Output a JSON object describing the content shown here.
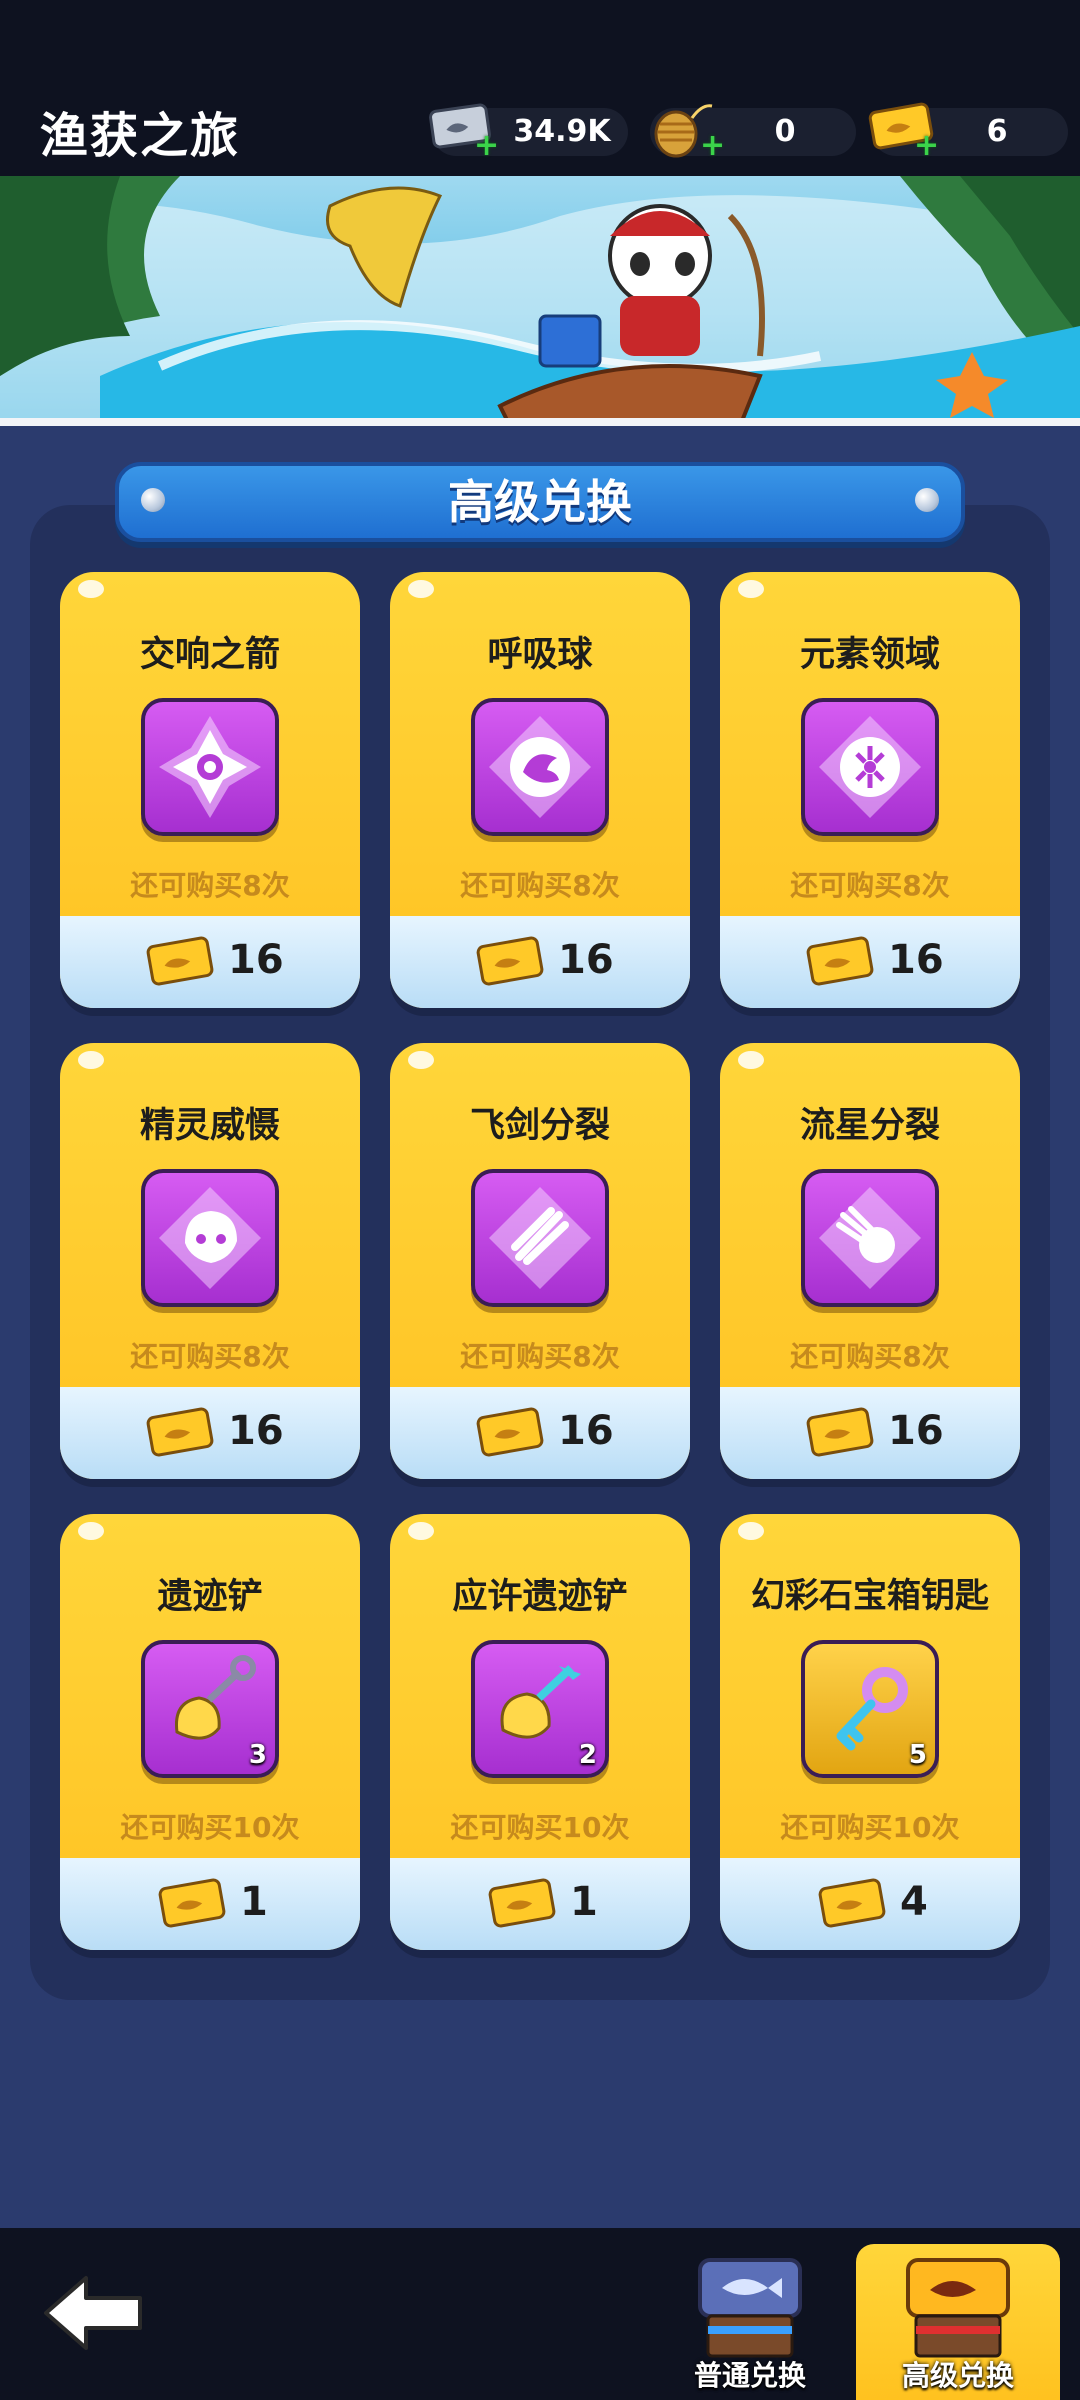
{
  "header": {
    "title": "渔获之旅",
    "currencies": [
      {
        "name": "ticket-silver",
        "value": "34.9K"
      },
      {
        "name": "fishing-line",
        "value": "0"
      },
      {
        "name": "ticket-gold",
        "value": "6"
      }
    ]
  },
  "section": {
    "title": "高级兑换"
  },
  "items": [
    {
      "name": "交响之箭",
      "limit": "还可购买8次",
      "price": "16",
      "icon": "compass-rune-icon"
    },
    {
      "name": "呼吸球",
      "limit": "还可购买8次",
      "price": "16",
      "icon": "dragon-orb-icon"
    },
    {
      "name": "元素领域",
      "limit": "还可购买8次",
      "price": "16",
      "icon": "elements-icon"
    },
    {
      "name": "精灵威慑",
      "limit": "还可购买8次",
      "price": "16",
      "icon": "spirit-icon"
    },
    {
      "name": "飞剑分裂",
      "limit": "还可购买8次",
      "price": "16",
      "icon": "flying-sword-icon"
    },
    {
      "name": "流星分裂",
      "limit": "还可购买8次",
      "price": "16",
      "icon": "meteor-icon"
    },
    {
      "name": "遗迹铲",
      "limit": "还可购买10次",
      "price": "1",
      "icon": "shovel-icon",
      "count": "3"
    },
    {
      "name": "应许遗迹铲",
      "limit": "还可购买10次",
      "price": "1",
      "icon": "blessed-shovel-icon",
      "count": "2"
    },
    {
      "name": "幻彩石宝箱钥匙",
      "limit": "还可购买10次",
      "price": "4",
      "icon": "key-icon",
      "count": "5"
    }
  ],
  "bottom_tabs": [
    {
      "label": "普通兑换",
      "active": false
    },
    {
      "label": "高级兑换",
      "active": true
    }
  ],
  "colors": {
    "card_yellow": "#ffc82a",
    "panel_navy": "#23305c",
    "item_purple": "#a62fd0",
    "limit_brown": "#c68a1d"
  }
}
